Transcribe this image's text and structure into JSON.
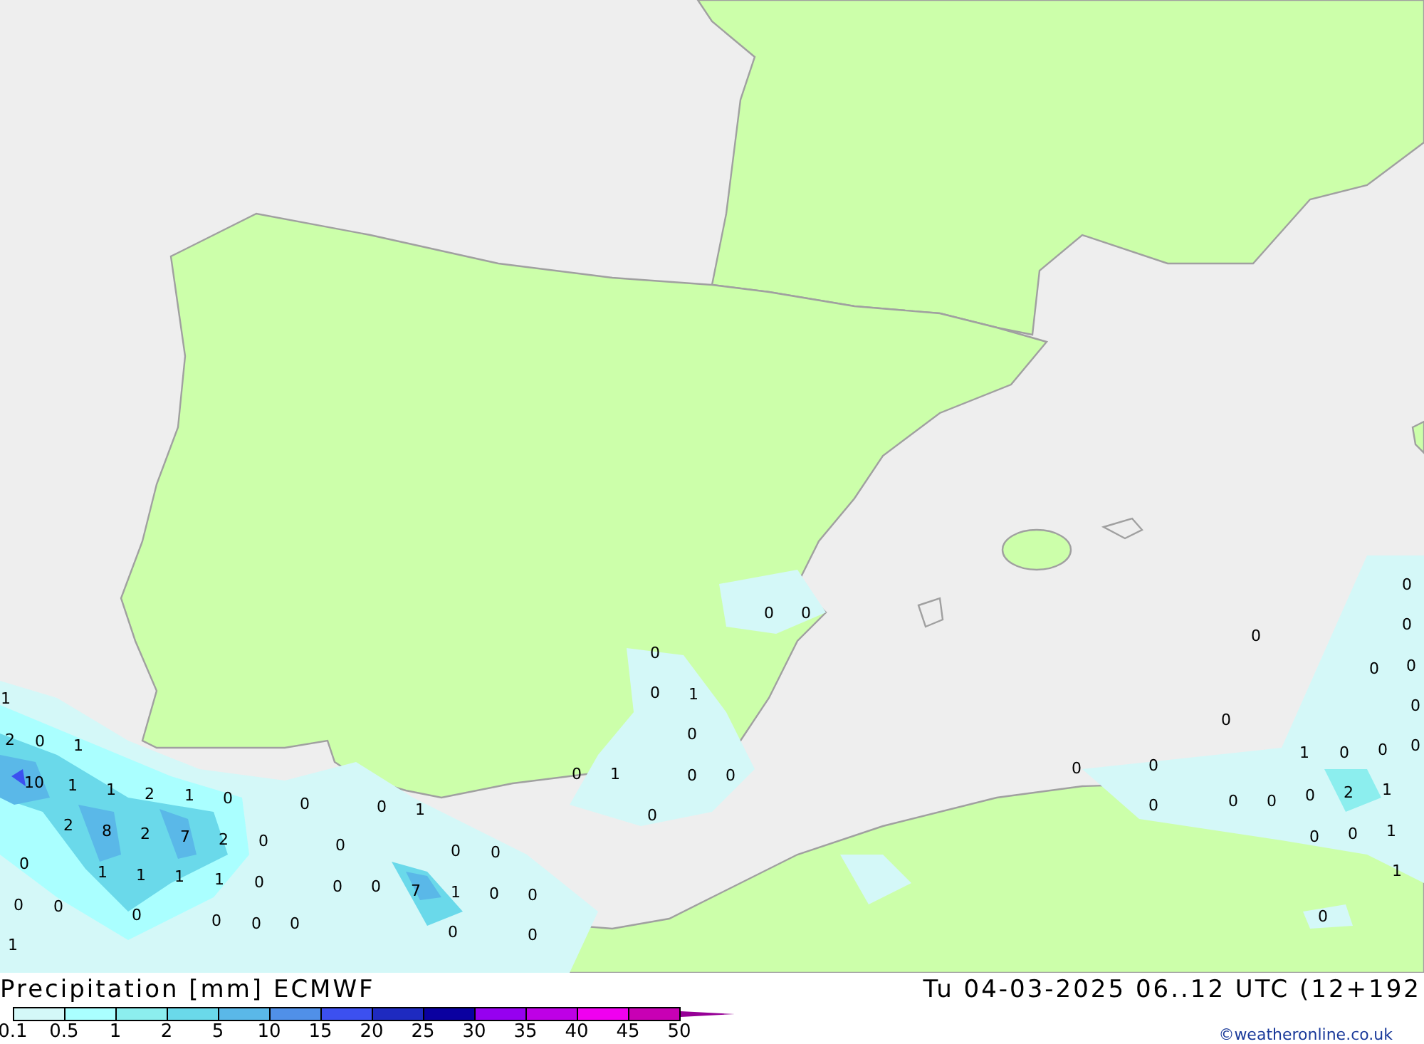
{
  "map": {
    "values": [
      {
        "value": "0"
      },
      {
        "value": "0"
      },
      {
        "value": "0"
      },
      {
        "value": "0"
      },
      {
        "value": "0"
      },
      {
        "value": "0"
      },
      {
        "value": "0"
      },
      {
        "value": "0"
      },
      {
        "value": "1"
      },
      {
        "value": "0"
      },
      {
        "value": "1"
      },
      {
        "value": "0"
      },
      {
        "value": "0"
      },
      {
        "value": "0"
      },
      {
        "value": "2"
      },
      {
        "value": "0"
      },
      {
        "value": "1"
      },
      {
        "value": "1"
      },
      {
        "value": "0"
      },
      {
        "value": "0"
      },
      {
        "value": "0"
      },
      {
        "value": "0"
      },
      {
        "value": "1"
      },
      {
        "value": "0"
      },
      {
        "value": "0"
      },
      {
        "value": "0"
      },
      {
        "value": "0"
      },
      {
        "value": "10"
      },
      {
        "value": "1"
      },
      {
        "value": "1"
      },
      {
        "value": "2"
      },
      {
        "value": "1"
      },
      {
        "value": "0"
      },
      {
        "value": "0"
      },
      {
        "value": "0"
      },
      {
        "value": "0"
      },
      {
        "value": "2"
      },
      {
        "value": "1"
      },
      {
        "value": "0"
      },
      {
        "value": "0"
      },
      {
        "value": "1"
      },
      {
        "value": "0"
      },
      {
        "value": "0"
      },
      {
        "value": "2"
      },
      {
        "value": "8"
      },
      {
        "value": "2"
      },
      {
        "value": "7"
      },
      {
        "value": "2"
      },
      {
        "value": "0"
      },
      {
        "value": "0"
      },
      {
        "value": "0"
      },
      {
        "value": "0"
      },
      {
        "value": "0"
      },
      {
        "value": "0"
      },
      {
        "value": "1"
      },
      {
        "value": "0"
      },
      {
        "value": "1"
      },
      {
        "value": "1"
      },
      {
        "value": "1"
      },
      {
        "value": "1"
      },
      {
        "value": "0"
      },
      {
        "value": "0"
      },
      {
        "value": "0"
      },
      {
        "value": "7"
      },
      {
        "value": "1"
      },
      {
        "value": "0"
      },
      {
        "value": "0"
      },
      {
        "value": "1"
      },
      {
        "value": "0"
      },
      {
        "value": "0"
      },
      {
        "value": "0"
      },
      {
        "value": "0"
      },
      {
        "value": "0"
      },
      {
        "value": "0"
      },
      {
        "value": "0"
      },
      {
        "value": "1"
      },
      {
        "value": "0"
      },
      {
        "value": "0"
      }
    ]
  },
  "legend": {
    "title": "Precipitation [mm] ECMWF",
    "scale": [
      {
        "kind": "box",
        "color": "#d4f8f8"
      },
      {
        "kind": "box",
        "color": "#aaffff"
      },
      {
        "kind": "box",
        "color": "#8ceeee"
      },
      {
        "kind": "box",
        "color": "#6ad9ea"
      },
      {
        "kind": "box",
        "color": "#5ab8e8"
      },
      {
        "kind": "box",
        "color": "#5090e8"
      },
      {
        "kind": "box",
        "color": "#3c50f0"
      },
      {
        "kind": "box",
        "color": "#1e2ac0"
      },
      {
        "kind": "box",
        "color": "#0a00a0"
      },
      {
        "kind": "box",
        "color": "#9600f0"
      },
      {
        "kind": "box",
        "color": "#be00e6"
      },
      {
        "kind": "box",
        "color": "#f000f0"
      },
      {
        "kind": "box",
        "color": "#c800b4"
      },
      {
        "kind": "arrow",
        "color": "#960096"
      }
    ],
    "ticks": [
      "0.1",
      "0.5",
      "1",
      "2",
      "5",
      "10",
      "15",
      "20",
      "25",
      "30",
      "35",
      "40",
      "45",
      "50"
    ]
  },
  "valid_time": "Tu 04-03-2025 06..12 UTC (12+192",
  "credit": "©weatheronline.co.uk"
}
